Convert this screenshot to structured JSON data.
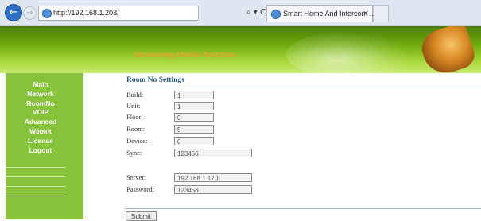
{
  "browser": {
    "back_icon": "arrow-left-icon",
    "forward_icon": "arrow-right-icon",
    "url": "http://192.168.1.203/",
    "address_tools": "⌕ ▾ C",
    "tab_title": "Smart Home And Intercom ...",
    "tab_close": "×"
  },
  "banner": {
    "slogan": "Streaming Media Solution"
  },
  "sidebar": {
    "items": [
      {
        "label": "Main"
      },
      {
        "label": "Network"
      },
      {
        "label": "RoomNo"
      },
      {
        "label": "VOIP"
      },
      {
        "label": "Advanced"
      },
      {
        "label": "Webkit"
      },
      {
        "label": "License"
      },
      {
        "label": "Logout"
      }
    ]
  },
  "main": {
    "title": "Room No Settings",
    "fields": {
      "build": {
        "label": "Build:",
        "value": "1"
      },
      "unit": {
        "label": "Unit:",
        "value": "1"
      },
      "floor": {
        "label": "Floor:",
        "value": "0"
      },
      "room": {
        "label": "Room:",
        "value": "5"
      },
      "device": {
        "label": "Device:",
        "value": "0"
      },
      "sync": {
        "label": "Sync:",
        "value": "123456"
      },
      "server": {
        "label": "Server:",
        "value": "192.168.1.170"
      },
      "password": {
        "label": "Password:",
        "value": "123456"
      }
    },
    "submit_label": "Submit"
  },
  "colors": {
    "sidebar_green": "#86c23a",
    "heading_blue": "#2a5b8a",
    "slogan_orange": "#e8a324"
  }
}
